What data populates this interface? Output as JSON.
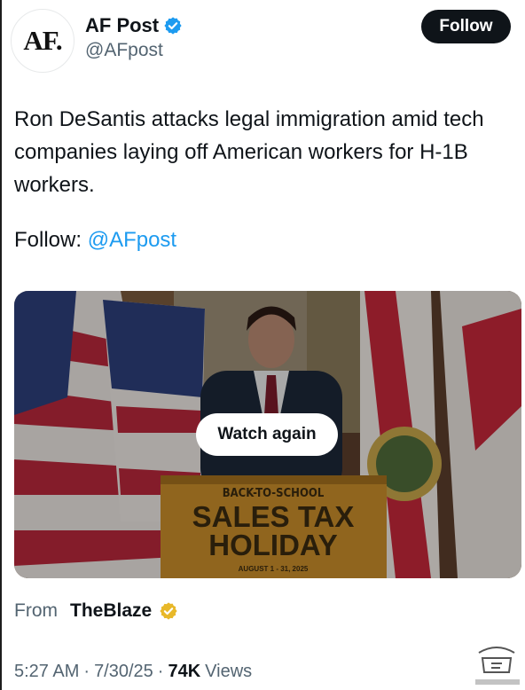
{
  "author": {
    "avatar_text": "AF.",
    "display_name": "AF Post",
    "handle": "@AFpost"
  },
  "follow_button": {
    "label": "Follow"
  },
  "tweet": {
    "text": "Ron DeSantis attacks legal immigration amid tech companies laying off American workers for H-1B workers.",
    "follow_prefix": "Follow:",
    "follow_mention": "@AFpost"
  },
  "media": {
    "watch_again_label": "Watch again",
    "podium_line1": "BACK-TO-SCHOOL",
    "podium_line2": "SALES TAX",
    "podium_line3": "HOLIDAY",
    "podium_line4": "AUGUST 1 - 31, 2025"
  },
  "source": {
    "from_label": "From",
    "name": "TheBlaze"
  },
  "meta": {
    "time": "5:27 AM",
    "date": "7/30/25",
    "views_count": "74K",
    "views_label": "Views",
    "separator": "·"
  },
  "colors": {
    "accent_blue": "#1d9bf0",
    "verified_gold": "#e8b829",
    "follow_button_bg": "#0f1419",
    "secondary_text": "#536471"
  }
}
